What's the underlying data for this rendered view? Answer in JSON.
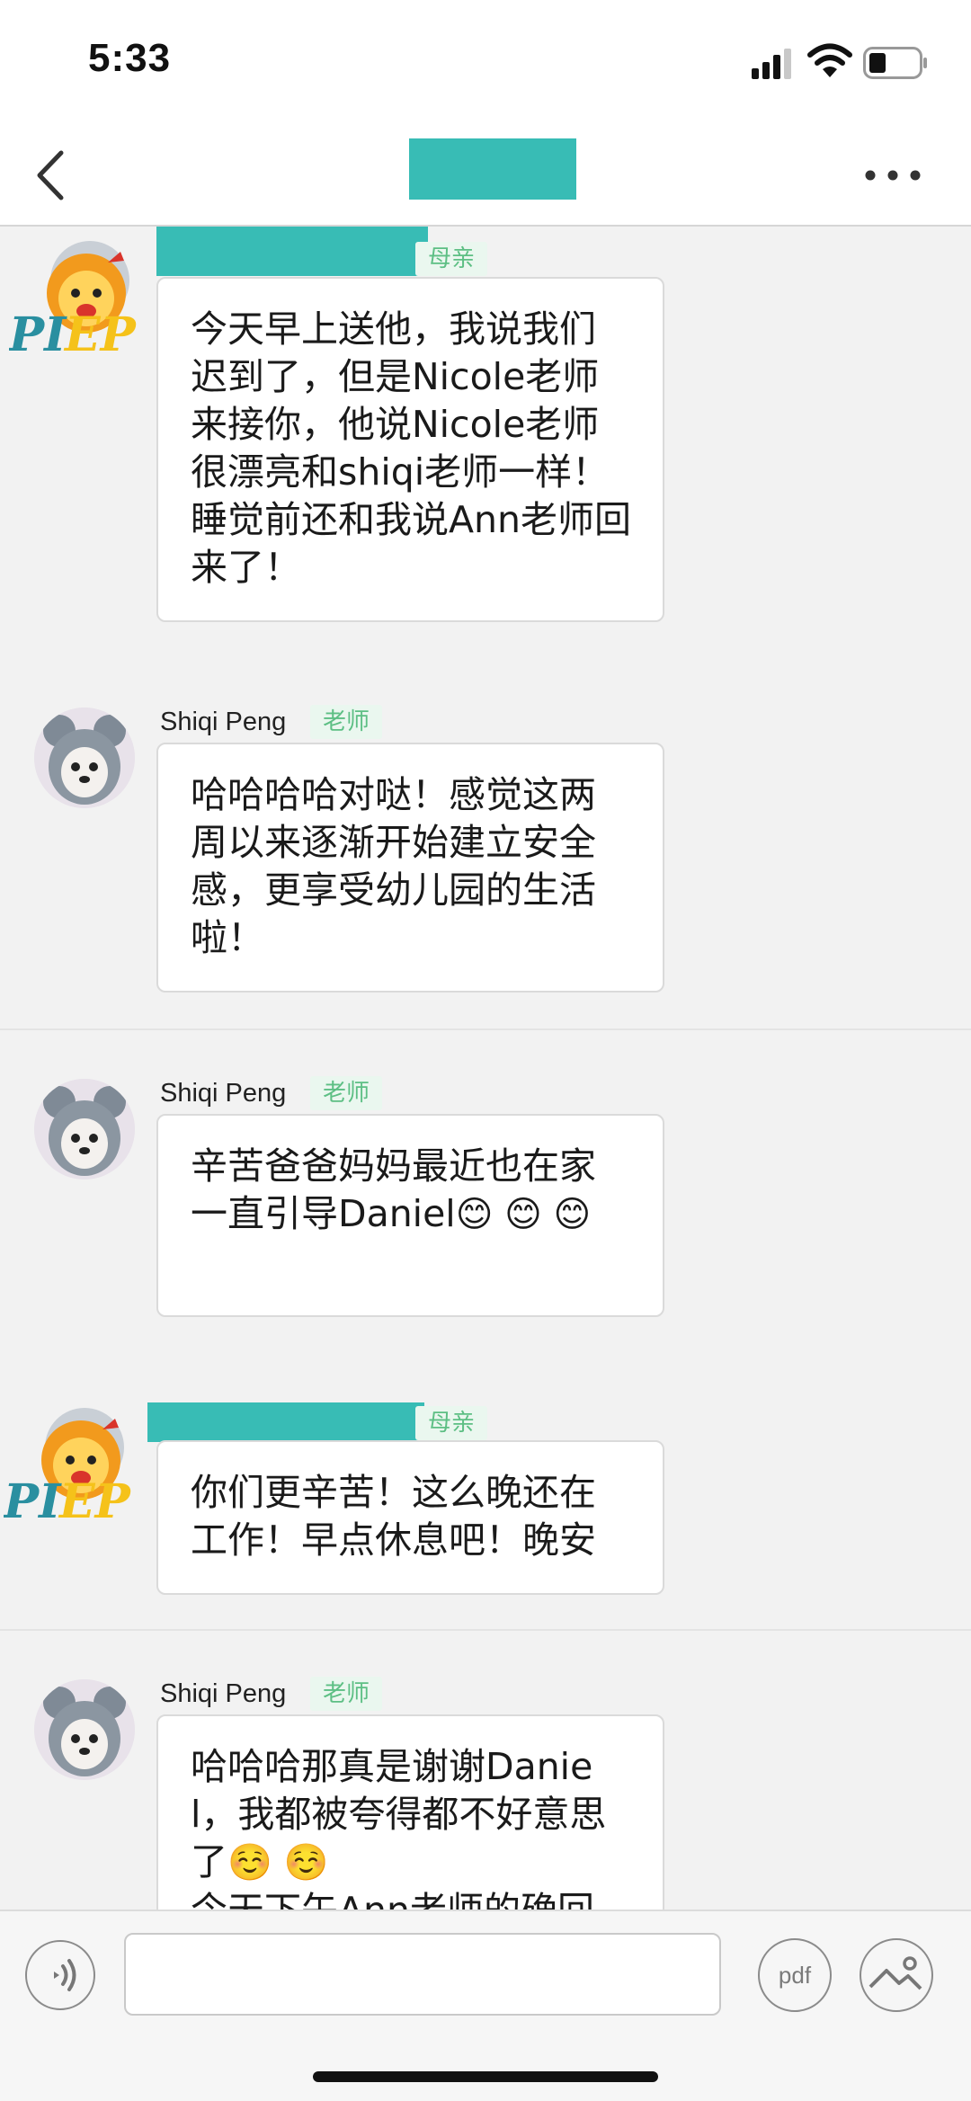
{
  "status_bar": {
    "time": "5:33"
  },
  "nav": {
    "back_icon": "chevron-left-icon",
    "more_icon": "more-dots-icon"
  },
  "messages": [
    {
      "sender_role": "母亲",
      "avatar": "piep-lion-logo",
      "avatar_text": "PIEP",
      "text": "今天早上送他，我说我们迟到了，但是Nicole老师来接你，他说Nicole老师很漂亮和shiqi老师一样！睡觉前还和我说Ann老师回来了！"
    },
    {
      "sender_name": "Shiqi Peng",
      "sender_role": "老师",
      "avatar": "puppy-photo",
      "text": "哈哈哈哈对哒！感觉这两周以来逐渐开始建立安全感，更享受幼儿园的生活啦！"
    },
    {
      "sender_name": "Shiqi Peng",
      "sender_role": "老师",
      "avatar": "puppy-photo",
      "text": "辛苦爸爸妈妈最近也在家一直引导Daniel",
      "emojis": "😊 😊 😊"
    },
    {
      "sender_role": "母亲",
      "avatar": "piep-lion-logo",
      "avatar_text": "PIEP",
      "text": "你们更辛苦！这么晚还在工作！早点休息吧！晚安"
    },
    {
      "sender_name": "Shiqi Peng",
      "sender_role": "老师",
      "avatar": "puppy-photo",
      "text_line1": "哈哈哈那真是谢谢Daniel，我都被夸得都不好意思了",
      "emojis": "☺️ ☺️",
      "text_line2": "今天下午Ann老师的确回"
    }
  ],
  "input_bar": {
    "voice_icon": "voice-icon",
    "pdf_label": "pdf",
    "image_icon": "image-icon",
    "text_value": ""
  },
  "colors": {
    "accent_redaction": "#38bcb5",
    "tag_green": "#5dbf84",
    "tag_bg": "#eaf7ef"
  }
}
